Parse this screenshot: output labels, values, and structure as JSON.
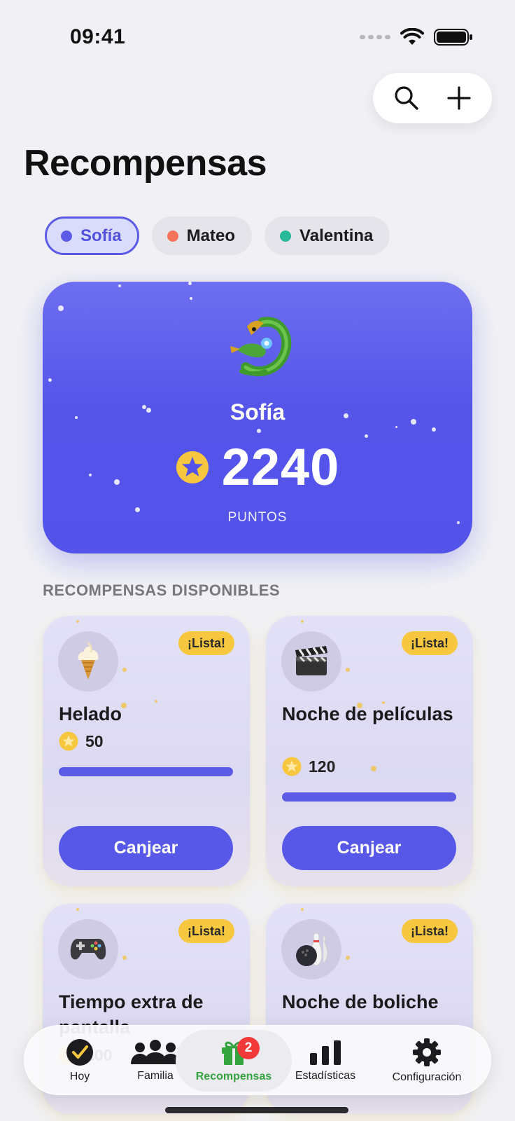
{
  "status_bar": {
    "time": "09:41"
  },
  "header": {
    "title": "Recompensas"
  },
  "children": [
    {
      "name": "Sofía",
      "color": "#5b5be6",
      "selected": true
    },
    {
      "name": "Mateo",
      "color": "#f4735a",
      "selected": false
    },
    {
      "name": "Valentina",
      "color": "#28b89a",
      "selected": false
    }
  ],
  "hero": {
    "avatar_icon": "dragon-emoji",
    "name": "Sofía",
    "points": "2240",
    "points_label": "PUNTOS"
  },
  "section_label": "RECOMPENSAS DISPONIBLES",
  "rewards": [
    {
      "icon": "ice-cream-emoji",
      "badge": "¡Lista!",
      "title": "Helado",
      "cost": "50",
      "progress": 1.0,
      "button": "Canjear"
    },
    {
      "icon": "clapper-board-emoji",
      "badge": "¡Lista!",
      "title": "Noche de películas",
      "cost": "120",
      "progress": 1.0,
      "button": "Canjear"
    },
    {
      "icon": "video-game-emoji",
      "badge": "¡Lista!",
      "title": "Tiempo extra de pantalla",
      "cost": "200"
    },
    {
      "icon": "bowling-emoji",
      "badge": "¡Lista!",
      "title": "Noche de boliche"
    }
  ],
  "tabbar": {
    "tabs": [
      {
        "label": "Hoy",
        "icon": "checkmark-circle-icon"
      },
      {
        "label": "Familia",
        "icon": "family-icon"
      },
      {
        "label": "Recompensas",
        "icon": "gift-icon",
        "badge": "2",
        "active": true
      },
      {
        "label": "Estadísticas",
        "icon": "bar-chart-icon"
      },
      {
        "label": "Configuración",
        "icon": "gear-icon"
      }
    ]
  },
  "colors": {
    "accent": "#5b5be6",
    "badge": "#f7c73f",
    "active_tab": "#34a43e",
    "notification": "#f23a3a"
  }
}
